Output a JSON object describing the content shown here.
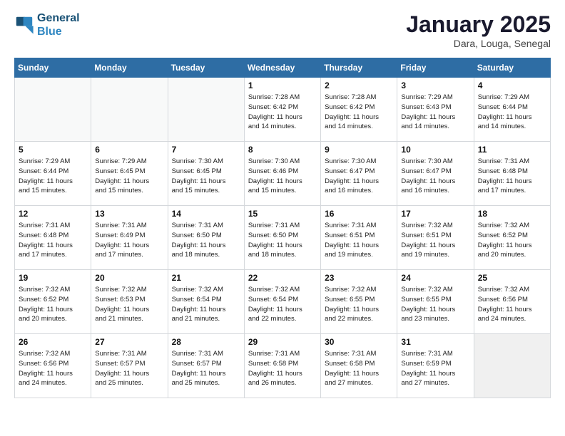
{
  "header": {
    "logo_line1": "General",
    "logo_line2": "Blue",
    "month_title": "January 2025",
    "subtitle": "Dara, Louga, Senegal"
  },
  "weekdays": [
    "Sunday",
    "Monday",
    "Tuesday",
    "Wednesday",
    "Thursday",
    "Friday",
    "Saturday"
  ],
  "weeks": [
    [
      {
        "day": "",
        "info": ""
      },
      {
        "day": "",
        "info": ""
      },
      {
        "day": "",
        "info": ""
      },
      {
        "day": "1",
        "info": "Sunrise: 7:28 AM\nSunset: 6:42 PM\nDaylight: 11 hours\nand 14 minutes."
      },
      {
        "day": "2",
        "info": "Sunrise: 7:28 AM\nSunset: 6:42 PM\nDaylight: 11 hours\nand 14 minutes."
      },
      {
        "day": "3",
        "info": "Sunrise: 7:29 AM\nSunset: 6:43 PM\nDaylight: 11 hours\nand 14 minutes."
      },
      {
        "day": "4",
        "info": "Sunrise: 7:29 AM\nSunset: 6:44 PM\nDaylight: 11 hours\nand 14 minutes."
      }
    ],
    [
      {
        "day": "5",
        "info": "Sunrise: 7:29 AM\nSunset: 6:44 PM\nDaylight: 11 hours\nand 15 minutes."
      },
      {
        "day": "6",
        "info": "Sunrise: 7:29 AM\nSunset: 6:45 PM\nDaylight: 11 hours\nand 15 minutes."
      },
      {
        "day": "7",
        "info": "Sunrise: 7:30 AM\nSunset: 6:45 PM\nDaylight: 11 hours\nand 15 minutes."
      },
      {
        "day": "8",
        "info": "Sunrise: 7:30 AM\nSunset: 6:46 PM\nDaylight: 11 hours\nand 15 minutes."
      },
      {
        "day": "9",
        "info": "Sunrise: 7:30 AM\nSunset: 6:47 PM\nDaylight: 11 hours\nand 16 minutes."
      },
      {
        "day": "10",
        "info": "Sunrise: 7:30 AM\nSunset: 6:47 PM\nDaylight: 11 hours\nand 16 minutes."
      },
      {
        "day": "11",
        "info": "Sunrise: 7:31 AM\nSunset: 6:48 PM\nDaylight: 11 hours\nand 17 minutes."
      }
    ],
    [
      {
        "day": "12",
        "info": "Sunrise: 7:31 AM\nSunset: 6:48 PM\nDaylight: 11 hours\nand 17 minutes."
      },
      {
        "day": "13",
        "info": "Sunrise: 7:31 AM\nSunset: 6:49 PM\nDaylight: 11 hours\nand 17 minutes."
      },
      {
        "day": "14",
        "info": "Sunrise: 7:31 AM\nSunset: 6:50 PM\nDaylight: 11 hours\nand 18 minutes."
      },
      {
        "day": "15",
        "info": "Sunrise: 7:31 AM\nSunset: 6:50 PM\nDaylight: 11 hours\nand 18 minutes."
      },
      {
        "day": "16",
        "info": "Sunrise: 7:31 AM\nSunset: 6:51 PM\nDaylight: 11 hours\nand 19 minutes."
      },
      {
        "day": "17",
        "info": "Sunrise: 7:32 AM\nSunset: 6:51 PM\nDaylight: 11 hours\nand 19 minutes."
      },
      {
        "day": "18",
        "info": "Sunrise: 7:32 AM\nSunset: 6:52 PM\nDaylight: 11 hours\nand 20 minutes."
      }
    ],
    [
      {
        "day": "19",
        "info": "Sunrise: 7:32 AM\nSunset: 6:52 PM\nDaylight: 11 hours\nand 20 minutes."
      },
      {
        "day": "20",
        "info": "Sunrise: 7:32 AM\nSunset: 6:53 PM\nDaylight: 11 hours\nand 21 minutes."
      },
      {
        "day": "21",
        "info": "Sunrise: 7:32 AM\nSunset: 6:54 PM\nDaylight: 11 hours\nand 21 minutes."
      },
      {
        "day": "22",
        "info": "Sunrise: 7:32 AM\nSunset: 6:54 PM\nDaylight: 11 hours\nand 22 minutes."
      },
      {
        "day": "23",
        "info": "Sunrise: 7:32 AM\nSunset: 6:55 PM\nDaylight: 11 hours\nand 22 minutes."
      },
      {
        "day": "24",
        "info": "Sunrise: 7:32 AM\nSunset: 6:55 PM\nDaylight: 11 hours\nand 23 minutes."
      },
      {
        "day": "25",
        "info": "Sunrise: 7:32 AM\nSunset: 6:56 PM\nDaylight: 11 hours\nand 24 minutes."
      }
    ],
    [
      {
        "day": "26",
        "info": "Sunrise: 7:32 AM\nSunset: 6:56 PM\nDaylight: 11 hours\nand 24 minutes."
      },
      {
        "day": "27",
        "info": "Sunrise: 7:31 AM\nSunset: 6:57 PM\nDaylight: 11 hours\nand 25 minutes."
      },
      {
        "day": "28",
        "info": "Sunrise: 7:31 AM\nSunset: 6:57 PM\nDaylight: 11 hours\nand 25 minutes."
      },
      {
        "day": "29",
        "info": "Sunrise: 7:31 AM\nSunset: 6:58 PM\nDaylight: 11 hours\nand 26 minutes."
      },
      {
        "day": "30",
        "info": "Sunrise: 7:31 AM\nSunset: 6:58 PM\nDaylight: 11 hours\nand 27 minutes."
      },
      {
        "day": "31",
        "info": "Sunrise: 7:31 AM\nSunset: 6:59 PM\nDaylight: 11 hours\nand 27 minutes."
      },
      {
        "day": "",
        "info": ""
      }
    ]
  ]
}
